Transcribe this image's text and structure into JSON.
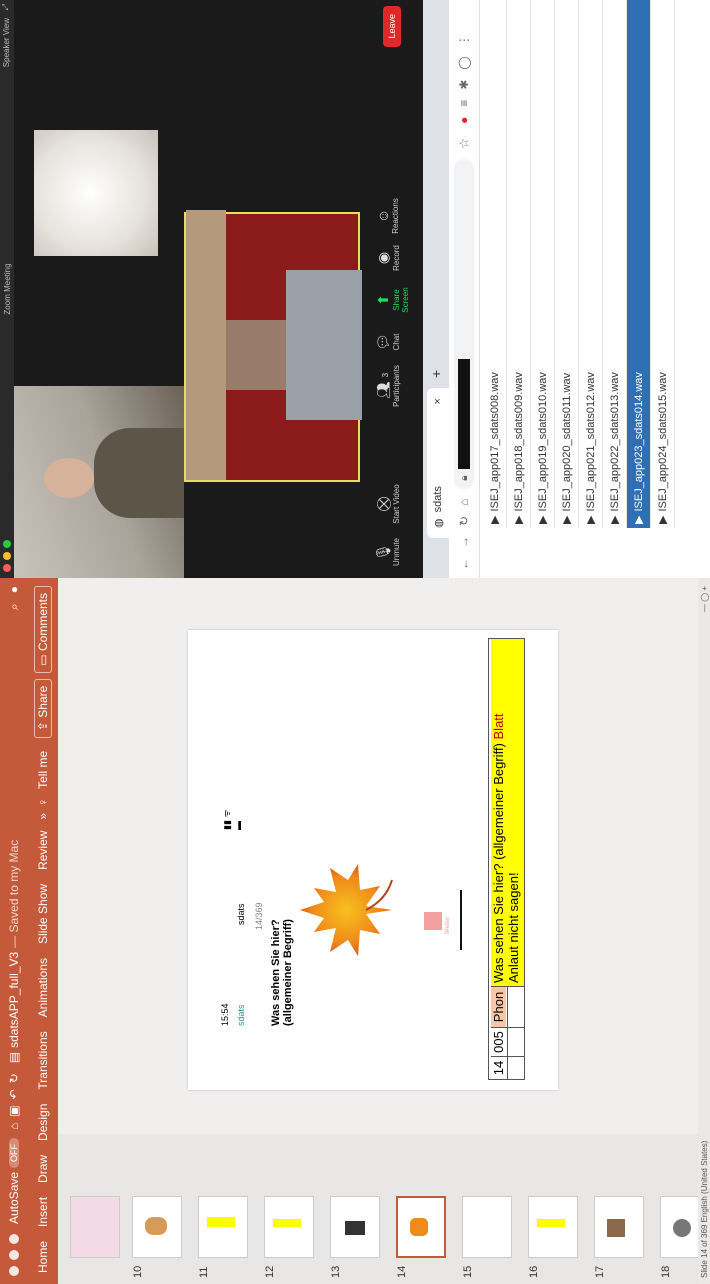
{
  "powerpoint": {
    "autosave": "AutoSave",
    "autosave_state": "OFF",
    "doc_title": "sdatsAPP_full_V3",
    "saved": "— Saved to my Mac",
    "tabs": [
      "Home",
      "Insert",
      "Draw",
      "Design",
      "Transitions",
      "Animations",
      "Slide Show",
      "Review"
    ],
    "tell_me": "Tell me",
    "share": "Share",
    "comments": "Comments",
    "slide_numbers": [
      "10",
      "11",
      "12",
      "13",
      "14",
      "15",
      "16",
      "17",
      "18"
    ],
    "selected_slide": "14",
    "slide": {
      "phone_time": "15:54",
      "phone_back": "sdats",
      "phone_app": "sdats",
      "phone_counter": "14/369",
      "question": "Was sehen Sie hier? (allgemeiner Begriff)",
      "btn_label": "Weiter",
      "table": {
        "num": "14",
        "code": "005",
        "type": "Phon",
        "text": "Was sehen Sie hier? (allgemeiner Begriff)",
        "answer": "Blatt",
        "note": "Anlaut nicht sagen!"
      }
    },
    "status_text": "Slide 14 of 369   English (United States)"
  },
  "zoom": {
    "title": "Zoom Meeting",
    "speaker_view": "Speaker View",
    "buttons": [
      "Unmute",
      "Start Video",
      "Participants",
      "Chat",
      "Share Screen",
      "Record",
      "Reactions"
    ],
    "participants_count": "3",
    "leave": "Leave"
  },
  "browser": {
    "tab_label": "sdats",
    "files": [
      "ISEJ_app017_sdats008.wav",
      "ISEJ_app018_sdats009.wav",
      "ISEJ_app019_sdats010.wav",
      "ISEJ_app020_sdats011.wav",
      "ISEJ_app021_sdats012.wav",
      "ISEJ_app022_sdats013.wav",
      "ISEJ_app023_sdats014.wav",
      "ISEJ_app024_sdats015.wav"
    ],
    "selected_file": "ISEJ_app023_sdats014.wav"
  },
  "colors": {
    "ppt_accent": "#c55a3b",
    "zoom_leave": "#e02828",
    "zoom_share": "#23d959",
    "selection_blue": "#2f6fb3",
    "table_yellow": "#ffff00",
    "table_peach": "#f7c7a6",
    "answer_red": "#c00000"
  }
}
